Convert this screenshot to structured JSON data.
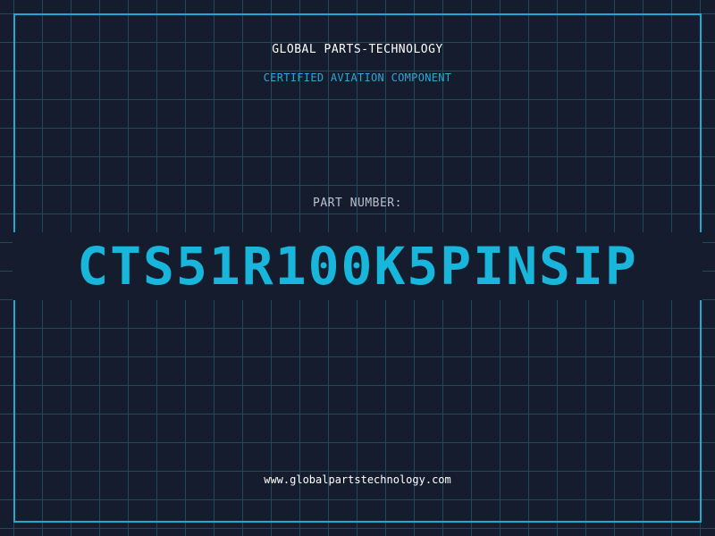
{
  "header": {
    "company": "GLOBAL PARTS-TECHNOLOGY",
    "tagline": "CERTIFIED AVIATION COMPONENT"
  },
  "part": {
    "label": "PART NUMBER:",
    "number": "CTS51R100K5PINSIP"
  },
  "footer": {
    "website": "www.globalpartstechnology.com"
  },
  "colors": {
    "background": "#141c2e",
    "grid": "#1f4a5e",
    "accent": "#19b6dc",
    "frame": "#1fa8d0",
    "text": "#ffffff",
    "muted": "#b9c0cc"
  }
}
